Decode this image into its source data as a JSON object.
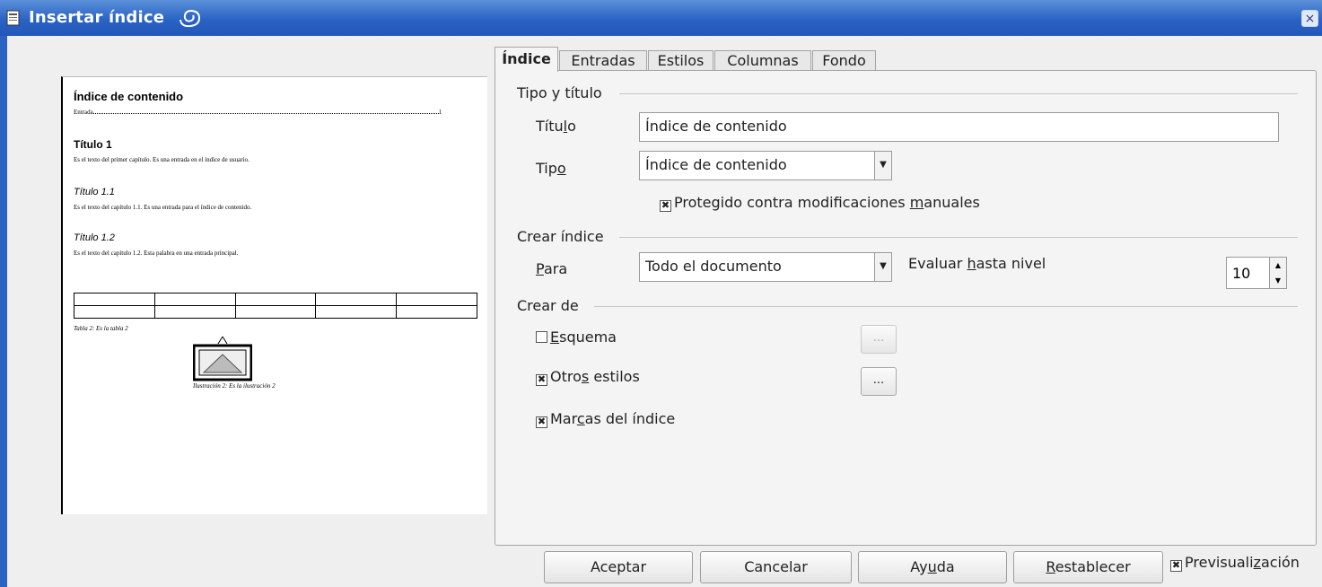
{
  "window": {
    "title": "Insertar índice",
    "close_label": "×"
  },
  "preview": {
    "toc_title": "Índice de contenido",
    "entry_text": "Entrada",
    "entry_page": "1",
    "h1": "Título 1",
    "h1_text": "Es el texto del primer capítulo. Es una entrada en el índice de usuario.",
    "h11": "Título 1.1",
    "h11_text": "Es el texto del capítulo 1.1. Es una entrada para el índice de contenido.",
    "h12": "Título 1.2",
    "h12_text": "Es el texto del capítulo 1.2. Esta palabra en una entrada principal.",
    "table_caption": "Tabla 2: Es la tabla 2",
    "illustration_caption": "Ilustración 2: Es la ilustración 2"
  },
  "tabs": [
    "Índice",
    "Entradas",
    "Estilos",
    "Columnas",
    "Fondo"
  ],
  "section_type": {
    "heading": "Tipo y título",
    "title_label": {
      "pre": "Títu",
      "u": "l",
      "post": "o"
    },
    "title_value": "Índice de contenido",
    "type_label": {
      "pre": "Tip",
      "u": "o",
      "post": ""
    },
    "type_value": "Índice de contenido",
    "protected": {
      "pre": "Protegido contra modificaciones ",
      "u": "m",
      "post": "anuales",
      "checked": true
    }
  },
  "section_create": {
    "heading": "Crear índice",
    "for_label": {
      "pre": "",
      "u": "P",
      "post": "ara"
    },
    "for_value": "Todo el documento",
    "eval_label": {
      "pre": "Evaluar ",
      "u": "h",
      "post": "asta nivel"
    },
    "level_value": "10"
  },
  "section_from": {
    "heading": "Crear de",
    "outline": {
      "pre": "",
      "u": "E",
      "post": "squema",
      "checked": false
    },
    "other_styles": {
      "pre": "Otro",
      "u": "s",
      "post": " estilos",
      "checked": true
    },
    "index_marks": {
      "pre": "Mar",
      "u": "c",
      "post": "as del índice",
      "checked": true
    },
    "dots_label": "..."
  },
  "buttons": {
    "ok": "Aceptar",
    "cancel": "Cancelar",
    "help": {
      "pre": "Ay",
      "u": "u",
      "post": "da"
    },
    "reset": {
      "pre": "",
      "u": "R",
      "post": "establecer"
    },
    "preview": {
      "pre": "Previsuali",
      "u": "z",
      "post": "ación",
      "checked": true
    }
  },
  "check_mark": "✖"
}
